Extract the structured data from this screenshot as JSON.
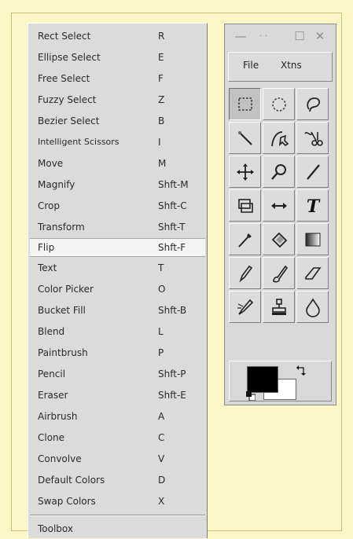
{
  "menu": {
    "items": [
      {
        "label": "Rect Select",
        "key": "R"
      },
      {
        "label": "Ellipse Select",
        "key": "E"
      },
      {
        "label": "Free Select",
        "key": "F"
      },
      {
        "label": "Fuzzy Select",
        "key": "Z"
      },
      {
        "label": "Bezier Select",
        "key": "B"
      },
      {
        "label": "Intelligent Scissors",
        "key": "I"
      },
      {
        "label": "Move",
        "key": "M"
      },
      {
        "label": "Magnify",
        "key": "Shft-M"
      },
      {
        "label": "Crop",
        "key": "Shft-C"
      },
      {
        "label": "Transform",
        "key": "Shft-T"
      },
      {
        "label": "Flip",
        "key": "Shft-F",
        "active": true
      },
      {
        "label": "Text",
        "key": "T"
      },
      {
        "label": "Color Picker",
        "key": "O"
      },
      {
        "label": "Bucket Fill",
        "key": "Shft-B"
      },
      {
        "label": "Blend",
        "key": "L"
      },
      {
        "label": "Paintbrush",
        "key": "P"
      },
      {
        "label": "Pencil",
        "key": "Shft-P"
      },
      {
        "label": "Eraser",
        "key": "Shft-E"
      },
      {
        "label": "Airbrush",
        "key": "A"
      },
      {
        "label": "Clone",
        "key": "C"
      },
      {
        "label": "Convolve",
        "key": "V"
      },
      {
        "label": "Default Colors",
        "key": "D"
      },
      {
        "label": "Swap Colors",
        "key": "X"
      }
    ],
    "footer_item": "Toolbox"
  },
  "toolbox": {
    "title_controls": {
      "minimize": "—",
      "dots": "· ·",
      "maximize": "☐",
      "close": "✕"
    },
    "menubar": {
      "file": "File",
      "xtns": "Xtns"
    },
    "tools": [
      "rect-select-icon",
      "ellipse-select-icon",
      "free-select-icon",
      "fuzzy-select-icon",
      "bezier-select-icon",
      "scissors-icon",
      "move-icon",
      "magnify-icon",
      "crop-icon",
      "transform-icon",
      "flip-icon",
      "text-icon",
      "color-picker-icon",
      "bucket-fill-icon",
      "blend-icon",
      "pencil-icon",
      "paintbrush-icon",
      "eraser-icon",
      "airbrush-icon",
      "clone-icon",
      "convolve-icon"
    ],
    "selected_tool": "rect-select-icon",
    "text_tool_glyph": "T",
    "colors": {
      "foreground": "#000000",
      "background": "#ffffff"
    }
  }
}
